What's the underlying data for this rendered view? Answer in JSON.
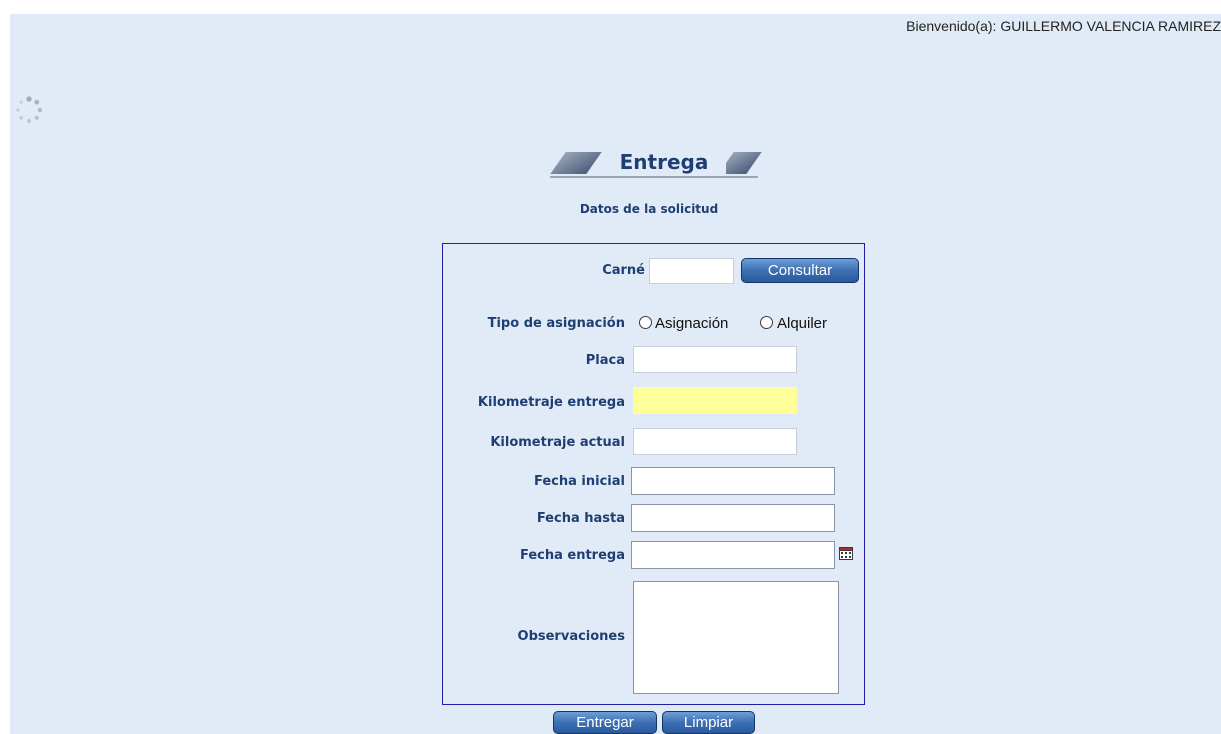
{
  "header": {
    "welcome_text": "Bienvenido(a): GUILLERMO VALENCIA RAMIREZ"
  },
  "page": {
    "title": "Entrega",
    "subtitle": "Datos de la solicitud"
  },
  "form": {
    "carne": {
      "label": "Carné",
      "value": ""
    },
    "consultar_label": "Consultar",
    "tipo_asignacion": {
      "label": "Tipo de asignación",
      "options": [
        "Asignación",
        "Alquiler"
      ],
      "selected": null
    },
    "placa": {
      "label": "Placa",
      "value": ""
    },
    "km_entrega": {
      "label": "Kilometraje entrega",
      "value": ""
    },
    "km_actual": {
      "label": "Kilometraje actual",
      "value": ""
    },
    "fecha_inicial": {
      "label": "Fecha inicial",
      "value": ""
    },
    "fecha_hasta": {
      "label": "Fecha hasta",
      "value": ""
    },
    "fecha_entrega": {
      "label": "Fecha entrega",
      "value": ""
    },
    "observaciones": {
      "label": "Observaciones",
      "value": ""
    }
  },
  "actions": {
    "entregar_label": "Entregar",
    "limpiar_label": "Limpiar"
  },
  "icons": {
    "loading": "loading-spinner-icon",
    "calendar": "calendar-icon"
  },
  "colors": {
    "panel_bg": "#e1ebf8",
    "label_text": "#1f3f72",
    "form_border": "#1e1ea8",
    "highlight_input": "#ffff99",
    "button_blue": "#3c6fb3"
  }
}
